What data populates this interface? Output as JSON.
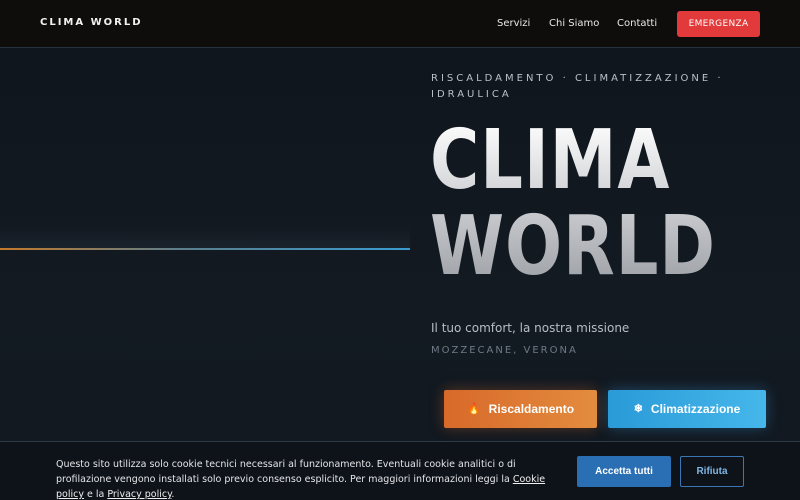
{
  "nav": {
    "brand": "CLIMA WORLD",
    "links": [
      "Servizi",
      "Chi Siamo",
      "Contatti"
    ],
    "emergency_label": "EMERGENZA"
  },
  "hero": {
    "tagline": "RISCALDAMENTO · CLIMATIZZAZIONE · IDRAULICA",
    "title_line1": "CLIMA",
    "title_line2": "WORLD",
    "subtitle": "Il tuo comfort, la nostra missione",
    "location": "MOZZECANE, VERONA",
    "cta_heating": {
      "icon": "flame-icon",
      "glyph": "🔥",
      "label": "Riscaldamento"
    },
    "cta_cooling": {
      "icon": "snowflake-icon",
      "glyph": "❄",
      "label": "Climatizzazione"
    }
  },
  "cookie": {
    "text_part1": "Questo sito utilizza solo cookie tecnici necessari al funzionamento. Eventuali cookie analitici o di profilazione vengono installati solo previo consenso esplicito. Per maggiori informazioni leggi la ",
    "cookie_policy_link": "Cookie policy",
    "text_part2": " e la ",
    "privacy_policy_link": "Privacy policy",
    "text_part3": ".",
    "accept_label": "Accetta tutti",
    "reject_label": "Rifiuta"
  },
  "colors": {
    "emergency": "#e23a3a",
    "heating": "#d8692a",
    "cooling": "#2a9ad8",
    "accept": "#2a6fb3"
  }
}
